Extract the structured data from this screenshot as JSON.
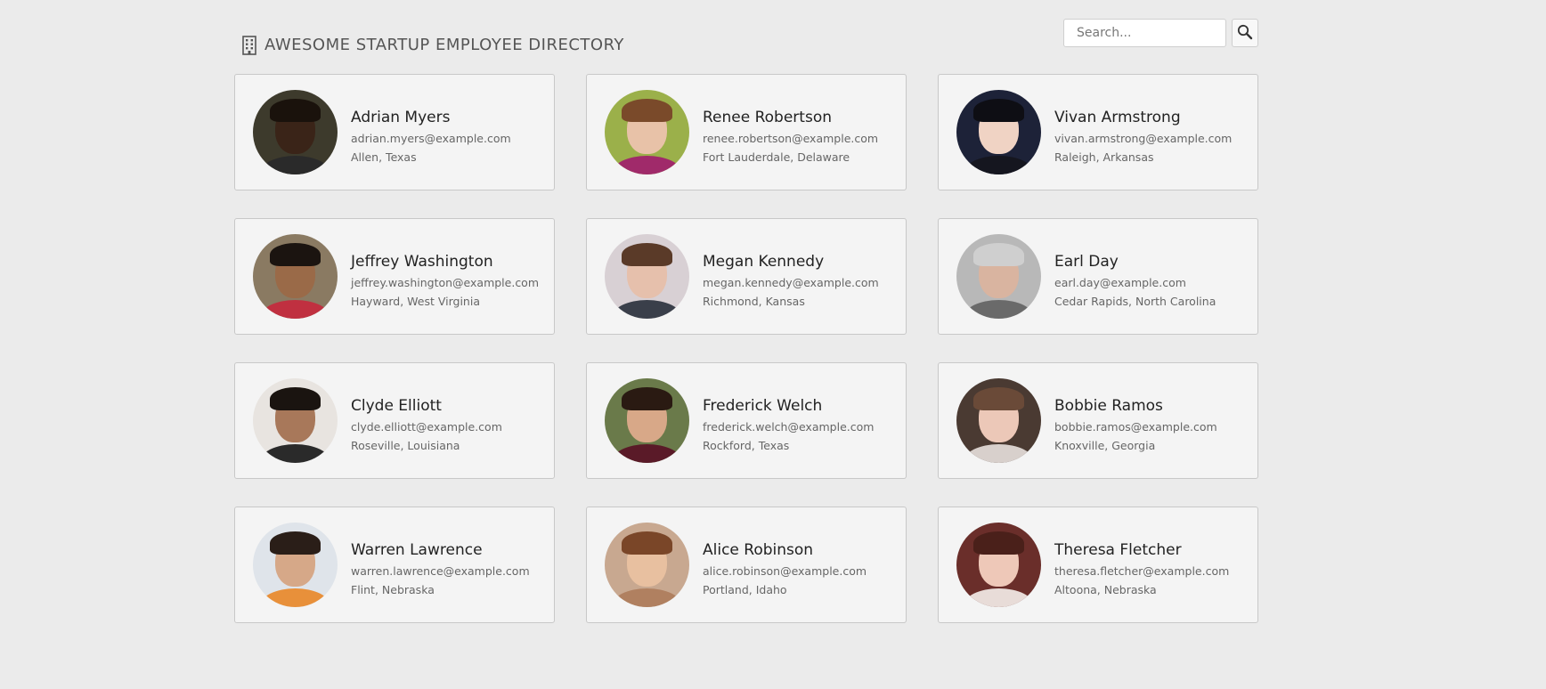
{
  "header": {
    "title": "AWESOME STARTUP EMPLOYEE DIRECTORY",
    "title_icon": "building-icon"
  },
  "search": {
    "placeholder": "Search...",
    "value": "",
    "button_icon": "search-icon"
  },
  "employees": [
    {
      "name": "Adrian Myers",
      "email": "adrian.myers@example.com",
      "location": "Allen, Texas",
      "avatar": {
        "bg": "#3d3a2c",
        "skin": "#3a2418",
        "hair": "#1a120c",
        "shirt": "#2a2a2a"
      }
    },
    {
      "name": "Renee Robertson",
      "email": "renee.robertson@example.com",
      "location": "Fort Lauderdale, Delaware",
      "avatar": {
        "bg": "#9bb04a",
        "skin": "#e8c2a8",
        "hair": "#7a4a2a",
        "shirt": "#a02a6a"
      }
    },
    {
      "name": "Vivan Armstrong",
      "email": "vivan.armstrong@example.com",
      "location": "Raleigh, Arkansas",
      "avatar": {
        "bg": "#1d2238",
        "skin": "#f0d3c4",
        "hair": "#0e0e14",
        "shirt": "#15161f"
      }
    },
    {
      "name": "Jeffrey Washington",
      "email": "jeffrey.washington@example.com",
      "location": "Hayward, West Virginia",
      "avatar": {
        "bg": "#8a7a62",
        "skin": "#9a6a48",
        "hair": "#1b1410",
        "shirt": "#c03040"
      }
    },
    {
      "name": "Megan Kennedy",
      "email": "megan.kennedy@example.com",
      "location": "Richmond, Kansas",
      "avatar": {
        "bg": "#d8d0d4",
        "skin": "#e6c0ac",
        "hair": "#5a3a28",
        "shirt": "#3a3f4a"
      }
    },
    {
      "name": "Earl Day",
      "email": "earl.day@example.com",
      "location": "Cedar Rapids, North Carolina",
      "avatar": {
        "bg": "#b8b8b8",
        "skin": "#d9b4a0",
        "hair": "#cfcfcf",
        "shirt": "#6a6a6a"
      }
    },
    {
      "name": "Clyde Elliott",
      "email": "clyde.elliott@example.com",
      "location": "Roseville, Louisiana",
      "avatar": {
        "bg": "#e8e4e0",
        "skin": "#a8785a",
        "hair": "#1a1410",
        "shirt": "#2a2a2a"
      }
    },
    {
      "name": "Frederick Welch",
      "email": "frederick.welch@example.com",
      "location": "Rockford, Texas",
      "avatar": {
        "bg": "#6a7a4a",
        "skin": "#d8a888",
        "hair": "#2a1a12",
        "shirt": "#5a1a28"
      }
    },
    {
      "name": "Bobbie Ramos",
      "email": "bobbie.ramos@example.com",
      "location": "Knoxville, Georgia",
      "avatar": {
        "bg": "#4a3a32",
        "skin": "#ecc8b8",
        "hair": "#6a4a38",
        "shirt": "#d8d0cc"
      }
    },
    {
      "name": "Warren Lawrence",
      "email": "warren.lawrence@example.com",
      "location": "Flint, Nebraska",
      "avatar": {
        "bg": "#dfe4ea",
        "skin": "#d6a888",
        "hair": "#2a1e18",
        "shirt": "#e8903a"
      }
    },
    {
      "name": "Alice Robinson",
      "email": "alice.robinson@example.com",
      "location": "Portland, Idaho",
      "avatar": {
        "bg": "#c8a890",
        "skin": "#e8c0a0",
        "hair": "#7a4628",
        "shirt": "#b08060"
      }
    },
    {
      "name": "Theresa Fletcher",
      "email": "theresa.fletcher@example.com",
      "location": "Altoona, Nebraska",
      "avatar": {
        "bg": "#6a2e2a",
        "skin": "#eec8b8",
        "hair": "#4a201a",
        "shirt": "#e8dcd8"
      }
    }
  ]
}
